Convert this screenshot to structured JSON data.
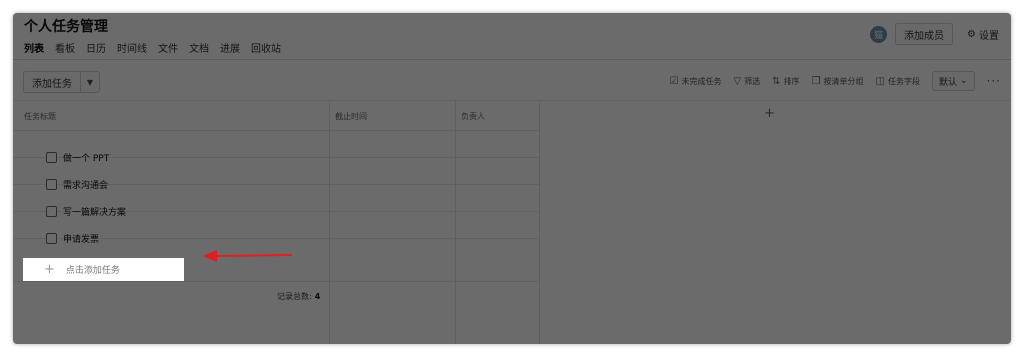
{
  "header": {
    "title": "个人任务管理",
    "tabs": [
      "列表",
      "看板",
      "日历",
      "时间线",
      "文件",
      "文档",
      "进展",
      "回收站"
    ],
    "avatar_text": "猫",
    "add_member_label": "添加成员",
    "settings_label": "设置"
  },
  "toolbar": {
    "add_task_label": "添加任务",
    "incomplete_label": "未完成任务",
    "filter_label": "筛选",
    "sort_label": "排序",
    "group_label": "按清单分组",
    "fields_label": "任务字段",
    "default_label": "默认"
  },
  "table": {
    "columns": [
      "任务标题",
      "截止时间",
      "负责人"
    ],
    "add_column_symbol": "+",
    "rows": [
      {
        "title": "做一个 PPT"
      },
      {
        "title": "需求沟通会"
      },
      {
        "title": "写一篇解决方案"
      },
      {
        "title": "申请发票"
      }
    ],
    "add_task_placeholder": "点击添加任务",
    "total_label": "记录总数:",
    "total_value": "4"
  },
  "colors": {
    "overlay": "#000000",
    "arrow": "#e02020",
    "avatar": "#6b8fa8"
  }
}
